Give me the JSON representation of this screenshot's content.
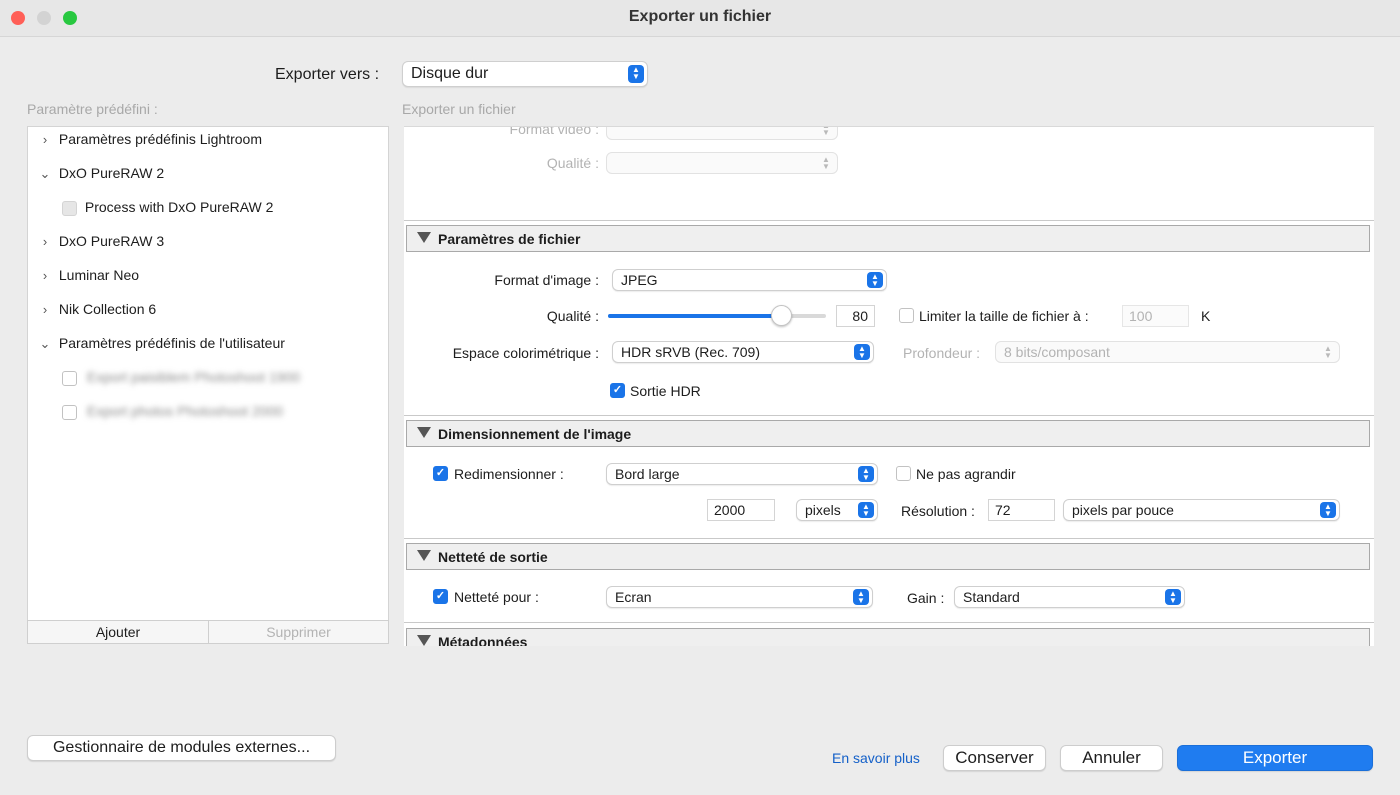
{
  "window": {
    "title": "Exporter un fichier"
  },
  "colors": {
    "accent": "#1a74e8",
    "close": "#ff5f57",
    "minimize": "#febc2e",
    "zoom": "#28c840"
  },
  "export_to": {
    "label": "Exporter vers :",
    "value": "Disque dur"
  },
  "presets": {
    "label": "Paramètre prédéfini :",
    "items": [
      {
        "label": "Paramètres prédéfinis Lightroom",
        "expanded": false
      },
      {
        "label": "DxO PureRAW 2",
        "expanded": true
      },
      {
        "label": "Process with DxO PureRAW 2",
        "child": true
      },
      {
        "label": "DxO PureRAW 3",
        "expanded": false
      },
      {
        "label": "Luminar Neo",
        "expanded": false
      },
      {
        "label": "Nik Collection 6",
        "expanded": false
      },
      {
        "label": "Paramètres prédéfinis de l'utilisateur",
        "expanded": true
      },
      {
        "label": "Export paisiblem Photoshoot 1900",
        "child": true,
        "blurred": true
      },
      {
        "label": "Export photos Photoshoot 2000",
        "child": true,
        "blurred": true
      }
    ],
    "add_label": "Ajouter",
    "remove_label": "Supprimer"
  },
  "main": {
    "header_label": "Exporter un fichier",
    "video": {
      "format_label": "Format vidéo :",
      "quality_label": "Qualité :"
    },
    "file_settings": {
      "title": "Paramètres de fichier",
      "format_label": "Format d'image :",
      "format_value": "JPEG",
      "quality_label": "Qualité :",
      "quality_value": "80",
      "quality_fraction": 0.8,
      "limit_label": "Limiter la taille de fichier à :",
      "limit_value": "100",
      "limit_unit": "K",
      "colorspace_label": "Espace colorimétrique :",
      "colorspace_value": "HDR sRVB (Rec. 709)",
      "depth_label": "Profondeur :",
      "depth_value": "8 bits/composant",
      "hdr_label": "Sortie HDR"
    },
    "sizing": {
      "title": "Dimensionnement de l'image",
      "resize_label": "Redimensionner :",
      "resize_value": "Bord large",
      "no_enlarge_label": "Ne pas agrandir",
      "size_value": "2000",
      "size_unit": "pixels",
      "resolution_label": "Résolution :",
      "resolution_value": "72",
      "resolution_unit": "pixels par pouce"
    },
    "sharpening": {
      "title": "Netteté de sortie",
      "sharpen_label": "Netteté pour :",
      "sharpen_value": "Ecran",
      "gain_label": "Gain :",
      "gain_value": "Standard"
    },
    "metadata": {
      "title": "Métadonnées"
    }
  },
  "footer": {
    "plugin_manager_label": "Gestionnaire de modules externes...",
    "learn_more_label": "En savoir plus",
    "keep_label": "Conserver",
    "cancel_label": "Annuler",
    "export_label": "Exporter"
  }
}
